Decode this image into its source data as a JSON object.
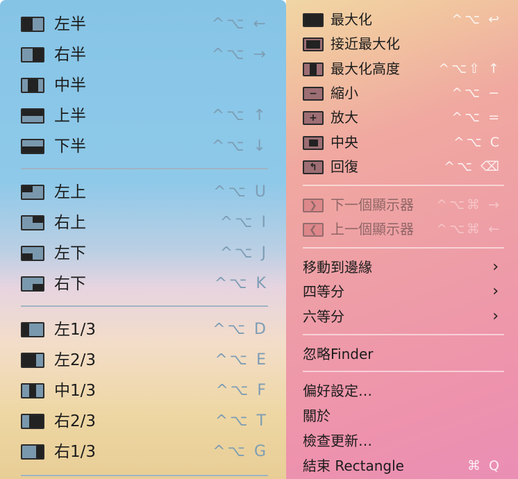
{
  "left_menu": {
    "groups": [
      [
        {
          "label": "左半",
          "shortcut": "^⌥ ←",
          "icon": "left-half-icon"
        },
        {
          "label": "右半",
          "shortcut": "^⌥ →",
          "icon": "right-half-icon"
        },
        {
          "label": "中半",
          "shortcut": "",
          "icon": "center-half-icon"
        },
        {
          "label": "上半",
          "shortcut": "^⌥ ↑",
          "icon": "top-half-icon"
        },
        {
          "label": "下半",
          "shortcut": "^⌥ ↓",
          "icon": "bottom-half-icon"
        }
      ],
      [
        {
          "label": "左上",
          "shortcut": "^⌥ U",
          "icon": "top-left-icon"
        },
        {
          "label": "右上",
          "shortcut": "^⌥ I",
          "icon": "top-right-icon"
        },
        {
          "label": "左下",
          "shortcut": "^⌥ J",
          "icon": "bottom-left-icon"
        },
        {
          "label": "右下",
          "shortcut": "^⌥ K",
          "icon": "bottom-right-icon"
        }
      ],
      [
        {
          "label": "左1/3",
          "shortcut": "^⌥ D",
          "icon": "first-third-icon"
        },
        {
          "label": "左2/3",
          "shortcut": "^⌥ E",
          "icon": "first-two-thirds-icon"
        },
        {
          "label": "中1/3",
          "shortcut": "^⌥ F",
          "icon": "center-third-icon"
        },
        {
          "label": "右2/3",
          "shortcut": "^⌥ T",
          "icon": "last-two-thirds-icon"
        },
        {
          "label": "右1/3",
          "shortcut": "^⌥ G",
          "icon": "last-third-icon"
        }
      ]
    ]
  },
  "right_menu": {
    "window_items": [
      {
        "label": "最大化",
        "shortcut": "^⌥ ↩",
        "icon": "maximize-icon",
        "disabled": false
      },
      {
        "label": "接近最大化",
        "shortcut": "",
        "icon": "almost-maximize-icon",
        "disabled": false
      },
      {
        "label": "最大化高度",
        "shortcut": "^⌥⇧ ↑",
        "icon": "maximize-height-icon",
        "disabled": false
      },
      {
        "label": "縮小",
        "shortcut": "^⌥ −",
        "icon": "smaller-icon",
        "disabled": false
      },
      {
        "label": "放大",
        "shortcut": "^⌥ =",
        "icon": "larger-icon",
        "disabled": false
      },
      {
        "label": "中央",
        "shortcut": "^⌥ C",
        "icon": "center-icon",
        "disabled": false
      },
      {
        "label": "回復",
        "shortcut": "^⌥ ⌫",
        "icon": "restore-icon",
        "disabled": false
      }
    ],
    "display_items": [
      {
        "label": "下一個顯示器",
        "shortcut": "^⌥⌘ →",
        "icon": "next-display-icon",
        "disabled": true
      },
      {
        "label": "上一個顯示器",
        "shortcut": "^⌥⌘ ←",
        "icon": "previous-display-icon",
        "disabled": true
      }
    ],
    "submenus": [
      {
        "label": "移動到邊緣",
        "chevron": "›"
      },
      {
        "label": "四等分",
        "chevron": "›"
      },
      {
        "label": "六等分",
        "chevron": "›"
      }
    ],
    "ignore_label": "忽略Finder",
    "app_items": [
      {
        "label": "偏好設定…",
        "shortcut": ""
      },
      {
        "label": "關於",
        "shortcut": ""
      },
      {
        "label": "檢查更新…",
        "shortcut": ""
      },
      {
        "label": "結束 Rectangle",
        "shortcut": "⌘ Q"
      }
    ]
  },
  "colors": {
    "left_shortcut": "#7d9db4",
    "icon_fill_left": "#7a98ad",
    "icon_fill_right": "#9d6e74"
  }
}
